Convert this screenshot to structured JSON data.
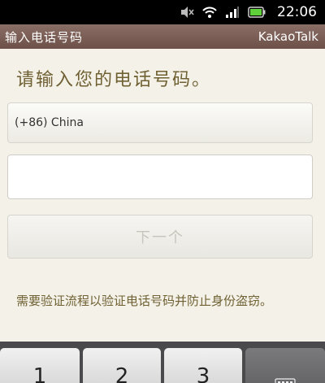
{
  "status_bar": {
    "time": "22:06",
    "icons": [
      "mute-icon",
      "wifi-icon",
      "signal-icon",
      "battery-icon"
    ],
    "color_bg": "#000000"
  },
  "title_bar": {
    "title": "输入电话号码",
    "brand": "KakaoTalk",
    "color_bg": "#7a5e55"
  },
  "prompt": "请输入您的电话号码。",
  "country_select": {
    "value": "(+86) China"
  },
  "phone_input": {
    "value": "",
    "placeholder": ""
  },
  "next_button": {
    "label": "下一个"
  },
  "notice": "需要验证流程以验证电话号码并防止身份盗窃。",
  "keyboard": {
    "keys": [
      "1",
      "2",
      "3"
    ],
    "menu_icon": "keyboard-grid-icon"
  },
  "colors": {
    "accent_text": "#6f6133",
    "background": "#f4f1e8"
  }
}
